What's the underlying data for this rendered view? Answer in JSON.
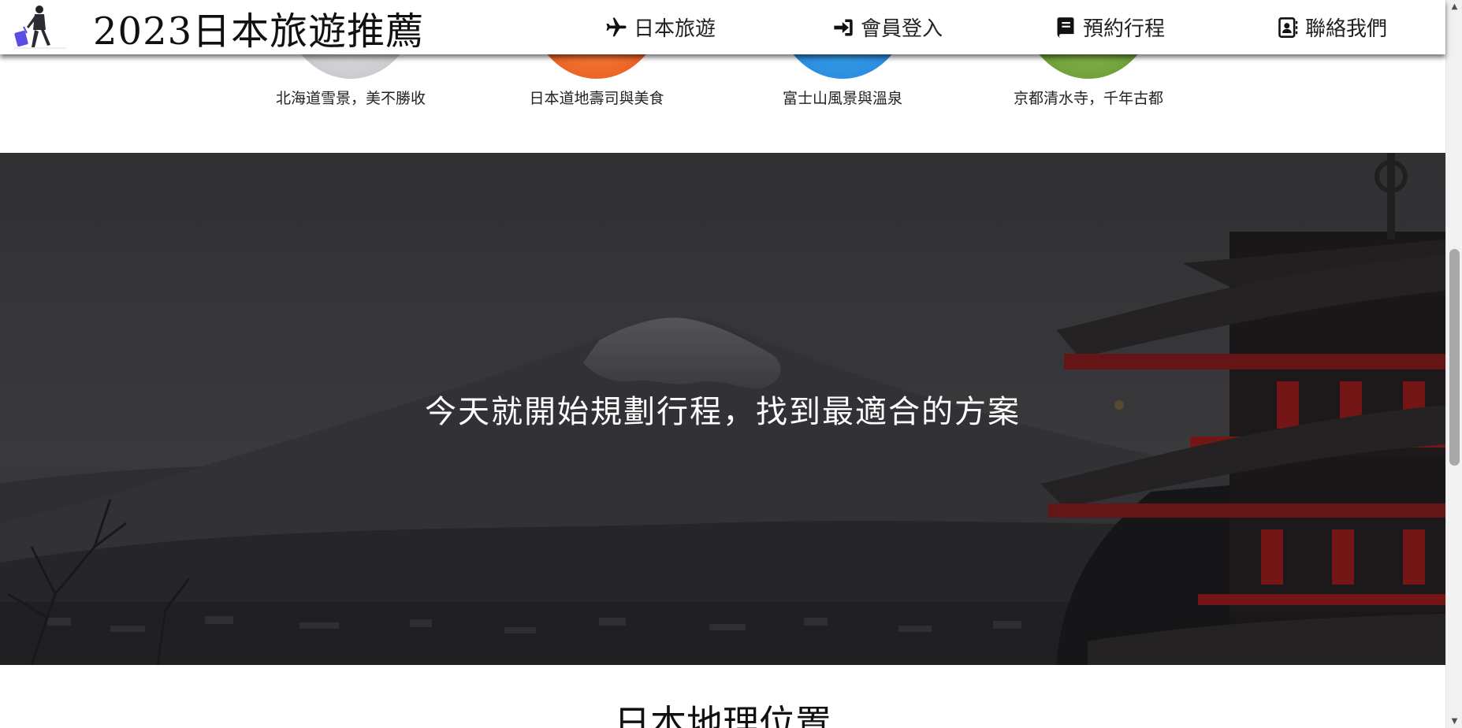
{
  "brand": {
    "title": "2023日本旅遊推薦"
  },
  "nav": [
    {
      "label": "日本旅遊",
      "icon": "airplane-icon"
    },
    {
      "label": "會員登入",
      "icon": "sign-in-icon"
    },
    {
      "label": "預約行程",
      "icon": "book-icon"
    },
    {
      "label": "聯絡我們",
      "icon": "contact-card-icon"
    }
  ],
  "destinations": [
    {
      "caption": "北海道雪景，美不勝收"
    },
    {
      "caption": "日本道地壽司與美食"
    },
    {
      "caption": "富士山風景與溫泉"
    },
    {
      "caption": "京都清水寺，千年古都"
    }
  ],
  "hero": {
    "text": "今天就開始規劃行程，找到最適合的方案"
  },
  "section": {
    "title": "日本地理位置"
  },
  "colors": {
    "navbar_bg": "#ffffff",
    "hero_overlay": "#3b3b3f",
    "text_light": "#ffffff",
    "pagoda_red": "#8e1c1c"
  }
}
